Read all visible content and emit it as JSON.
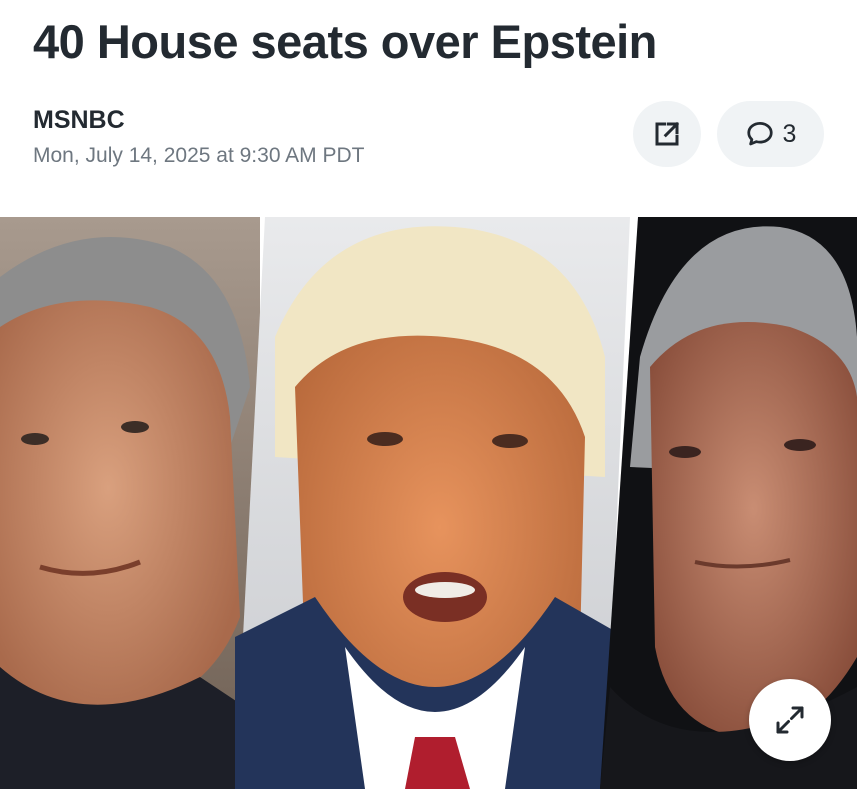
{
  "article": {
    "headline": "40 House seats over Epstein",
    "source": "MSNBC",
    "timestamp": "Mon, July 14, 2025 at 9:30 AM PDT"
  },
  "actions": {
    "share_icon": "external-link-icon",
    "comments_icon": "speech-bubble-icon",
    "comments_count": "3",
    "expand_icon": "expand-arrows-icon"
  },
  "hero_image": {
    "panels": [
      "left-portrait",
      "center-portrait",
      "right-portrait"
    ]
  },
  "colors": {
    "text": "#232a31",
    "muted": "#6e7780",
    "button_bg": "#f0f3f5"
  }
}
